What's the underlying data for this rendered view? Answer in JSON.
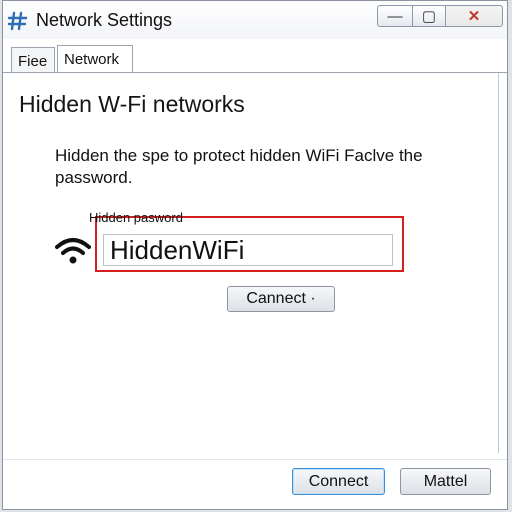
{
  "window": {
    "title": "Network Settings",
    "controls": {
      "minimize": "—",
      "maximize": "▢",
      "close": "✕"
    }
  },
  "tabs": [
    {
      "label": "Fiee",
      "active": false
    },
    {
      "label": "Network",
      "active": true
    }
  ],
  "main": {
    "heading": "Hidden W-Fi networks",
    "instructions": "Hidden the spe to protect hidden WiFi Faclve the password.",
    "field_label": "Hidden pasword",
    "password_value": "HiddenWiFi"
  },
  "buttons": {
    "middle": "Cannect ·",
    "connect": "Connect",
    "cancel": "Mattel"
  },
  "colors": {
    "highlight": "#d41f1f",
    "default_button_border": "#3b8fd6",
    "app_icon": "#2d6fb4"
  },
  "icons": {
    "app": "network-app-icon",
    "wifi": "wifi-signal-icon"
  }
}
